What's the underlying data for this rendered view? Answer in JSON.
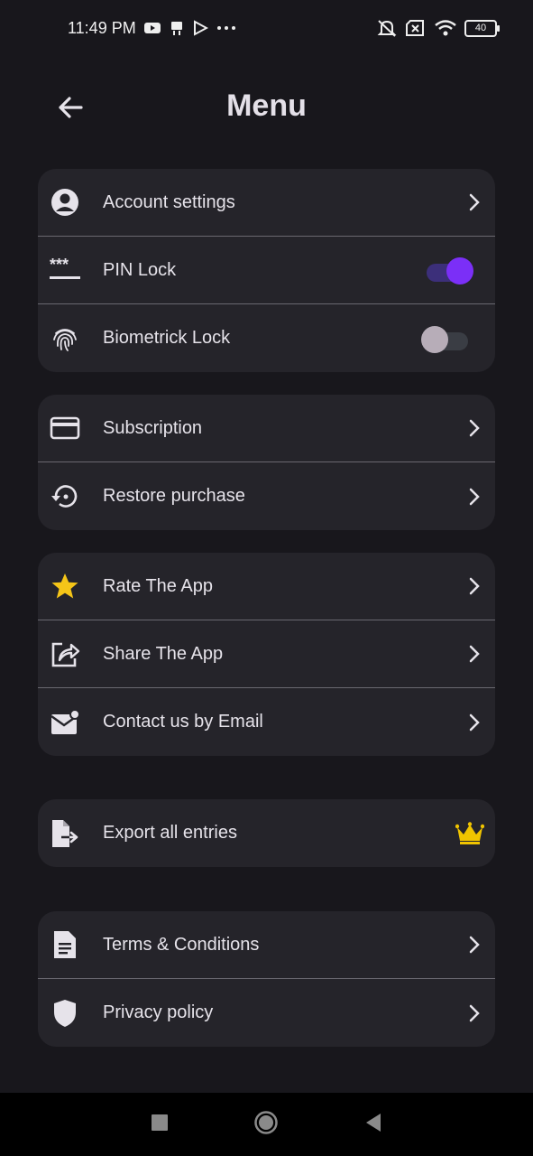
{
  "status_bar": {
    "time": "11:49 PM",
    "battery": "40",
    "left_icons": [
      "youtube-icon",
      "app-notification-icon",
      "play-store-icon",
      "more-icon"
    ],
    "right_icons": [
      "silent-icon",
      "sim-off-icon",
      "wifi-icon",
      "battery-icon"
    ]
  },
  "header": {
    "title": "Menu",
    "back_icon": "arrow-left-icon"
  },
  "colors": {
    "background": "#18171c",
    "card": "#25242a",
    "toggle_on": "#7b2ff7",
    "star": "#f5c518",
    "crown": "#f0c400"
  },
  "sections": [
    {
      "items": [
        {
          "label": "Account settings",
          "icon": "account-circle-icon",
          "control": "chevron"
        },
        {
          "label": "PIN Lock",
          "icon": "password-icon",
          "control": "toggle",
          "toggle_on": true
        },
        {
          "label": "Biometrick Lock",
          "icon": "fingerprint-icon",
          "control": "toggle",
          "toggle_on": false
        }
      ]
    },
    {
      "items": [
        {
          "label": "Subscription",
          "icon": "credit-card-icon",
          "control": "chevron"
        },
        {
          "label": "Restore purchase",
          "icon": "restore-icon",
          "control": "chevron"
        }
      ]
    },
    {
      "items": [
        {
          "label": "Rate The App",
          "icon": "star-icon",
          "control": "chevron"
        },
        {
          "label": "Share The App",
          "icon": "share-icon",
          "control": "chevron"
        },
        {
          "label": "Contact us by Email",
          "icon": "email-icon",
          "control": "chevron"
        }
      ]
    },
    {
      "items": [
        {
          "label": "Export all entries",
          "icon": "export-file-icon",
          "control": "crown"
        }
      ]
    },
    {
      "items": [
        {
          "label": "Terms & Conditions",
          "icon": "document-icon",
          "control": "chevron"
        },
        {
          "label": "Privacy policy",
          "icon": "shield-icon",
          "control": "chevron"
        }
      ]
    }
  ],
  "nav_bar": {
    "buttons": [
      "recents-button",
      "home-button",
      "back-button"
    ]
  }
}
